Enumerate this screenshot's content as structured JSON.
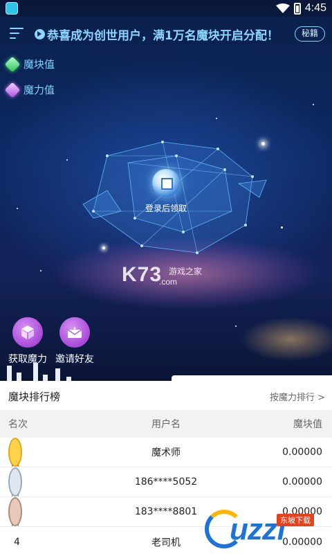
{
  "status_bar": {
    "time": "4:45"
  },
  "header": {
    "announcement": "恭喜成为创世用户，满1万名魔块开启分配！",
    "secret_button": "秘籍"
  },
  "stats": [
    {
      "label": "魔块值",
      "color": "#3fd46a"
    },
    {
      "label": "魔力值",
      "color": "#c46ef0"
    }
  ],
  "claim": {
    "label": "登录后领取"
  },
  "actions": [
    {
      "label": "获取魔力",
      "icon": "cube-icon"
    },
    {
      "label": "邀请好友",
      "icon": "envelope-icon"
    }
  ],
  "watermarks": {
    "k73_brand": "K73",
    "k73_sub": "游戏之家",
    "k73_com": ".com",
    "uzzf_brand": "uzzf",
    "uzzf_tag": "东坡下载"
  },
  "leaderboard": {
    "title": "魔块排行榜",
    "sort_link": "按魔力排行 >",
    "columns": {
      "rank": "名次",
      "user": "用户名",
      "value": "魔块值"
    },
    "rows": [
      {
        "rank": "",
        "rank_icon": "gold-medal-icon",
        "user": "魔术师",
        "value": "0.00000"
      },
      {
        "rank": "",
        "rank_icon": "silver-medal-icon",
        "user": "186****5052",
        "value": "0.00000"
      },
      {
        "rank": "",
        "rank_icon": "bronze-medal-icon",
        "user": "183****8801",
        "value": "0.00000"
      },
      {
        "rank": "4",
        "rank_icon": "",
        "user": "老司机",
        "value": "0.00000"
      }
    ]
  }
}
